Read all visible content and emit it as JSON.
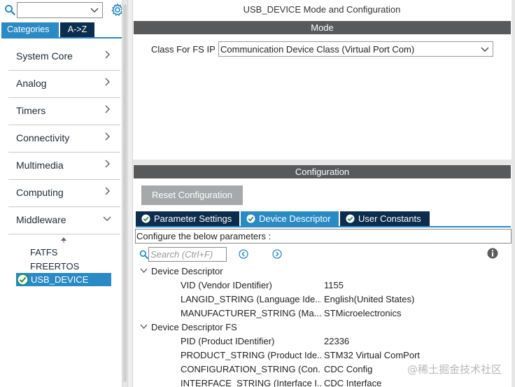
{
  "left_panel": {
    "search_icon": "search-icon",
    "settings_icon": "gear-icon",
    "tabs": [
      "Categories",
      "A->Z"
    ],
    "categories": [
      {
        "label": "System Core",
        "expanded": false
      },
      {
        "label": "Analog",
        "expanded": false
      },
      {
        "label": "Timers",
        "expanded": false
      },
      {
        "label": "Connectivity",
        "expanded": false
      },
      {
        "label": "Multimedia",
        "expanded": false
      },
      {
        "label": "Computing",
        "expanded": false
      },
      {
        "label": "Middleware",
        "expanded": true
      }
    ],
    "middleware_items": [
      "FATFS",
      "FREERTOS",
      "USB_DEVICE"
    ],
    "selected_item": "USB_DEVICE"
  },
  "right_panel": {
    "title": "USB_DEVICE Mode and Configuration",
    "mode_header": "Mode",
    "class_label": "Class For FS IP",
    "class_value": "Communication Device Class (Virtual Port Com)",
    "config_header": "Configuration",
    "reset_button": "Reset Configuration",
    "param_tabs": [
      "Parameter Settings",
      "Device Descriptor",
      "User Constants"
    ],
    "active_tab": "Device Descriptor",
    "configure_text": "Configure the below parameters :",
    "search_placeholder": "Search (Ctrl+F)",
    "tree": [
      {
        "group": "Device Descriptor",
        "params": [
          {
            "key": "VID (Vendor IDentifier)",
            "value": "1155"
          },
          {
            "key": "LANGID_STRING (Language Ide...",
            "value": "English(United States)"
          },
          {
            "key": "MANUFACTURER_STRING (Ma...",
            "value": "STMicroelectronics"
          }
        ]
      },
      {
        "group": "Device Descriptor FS",
        "params": [
          {
            "key": "PID (Product IDentifier)",
            "value": "22336"
          },
          {
            "key": "PRODUCT_STRING (Product Ide...",
            "value": "STM32 Virtual ComPort"
          },
          {
            "key": "CONFIGURATION_STRING (Con...",
            "value": "CDC Config"
          },
          {
            "key": "INTERFACE_STRING (Interface I...",
            "value": "CDC Interface"
          }
        ]
      }
    ]
  },
  "watermark": "@稀土掘金技术社区",
  "colors": {
    "accent": "#2a8ac4",
    "dark_tab": "#0c2d4d",
    "section_bar": "#58595b",
    "button": "#a6a9ab"
  }
}
